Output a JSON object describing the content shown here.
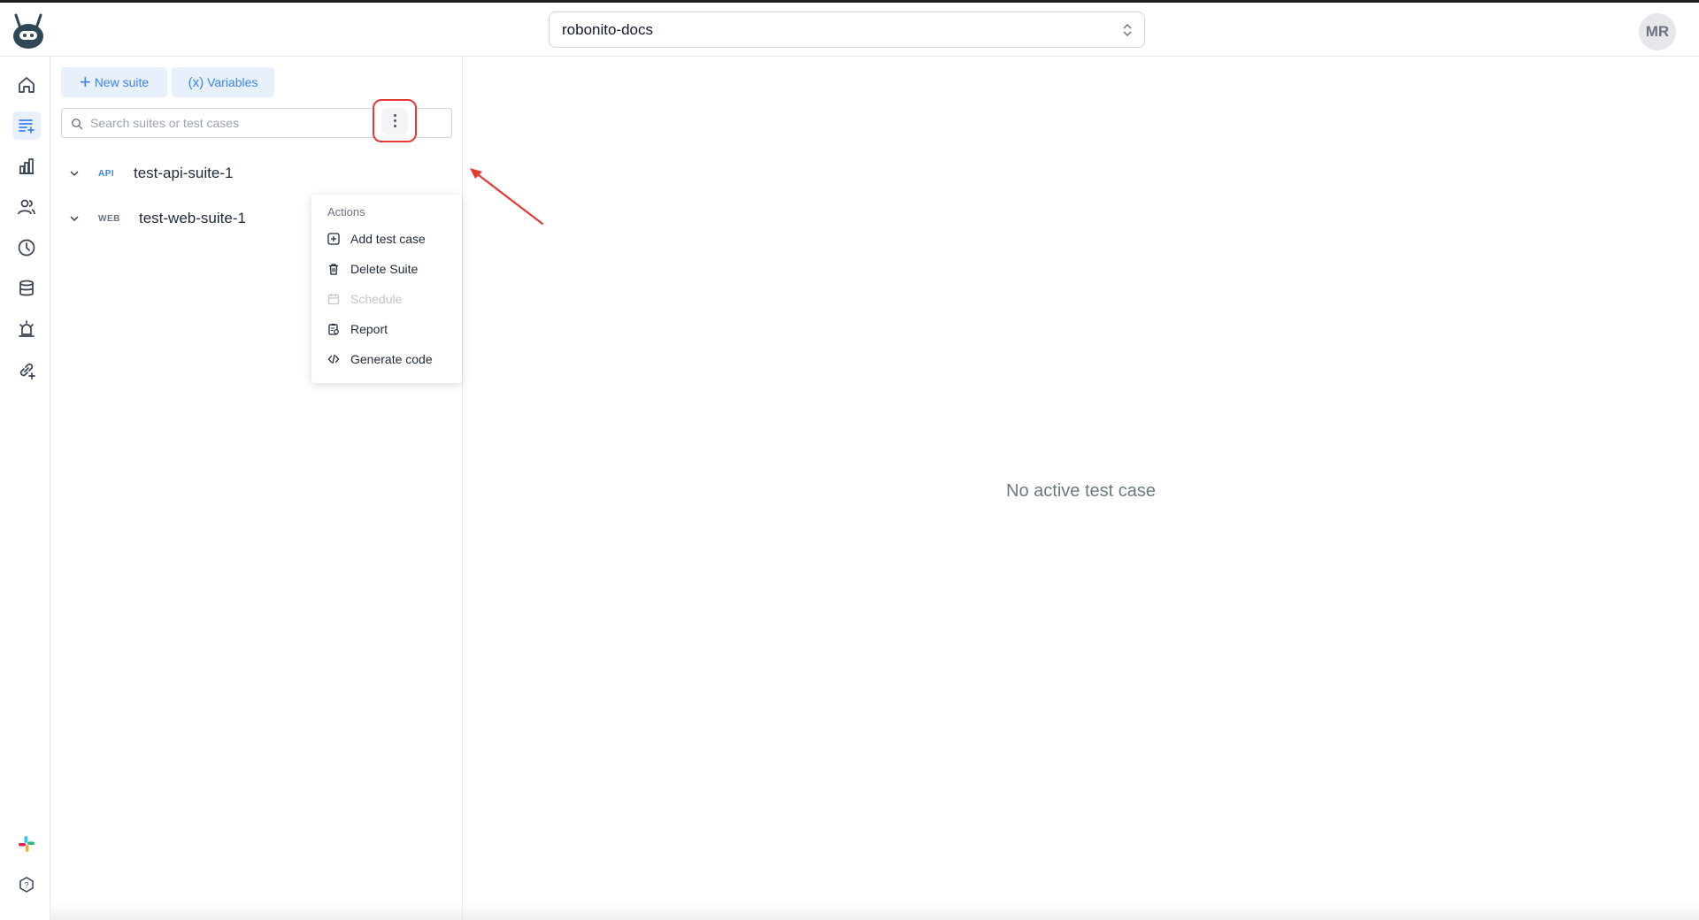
{
  "header": {
    "project_name": "robonito-docs",
    "avatar_initials": "MR"
  },
  "rail": {
    "items": [
      "home-icon",
      "test-suites-icon",
      "reports-icon",
      "team-icon",
      "history-icon",
      "database-icon",
      "alerts-icon",
      "integrations-icon"
    ],
    "bottom": [
      "slack-icon",
      "help-icon"
    ],
    "active": "test-suites-icon"
  },
  "panel": {
    "new_suite_label": "New suite",
    "variables_label": "Variables",
    "variables_icon_text": "(x)",
    "search_placeholder": "Search suites or test cases",
    "suites": [
      {
        "type": "API",
        "name": "test-api-suite-1"
      },
      {
        "type": "WEB",
        "name": "test-web-suite-1"
      }
    ]
  },
  "menu": {
    "title": "Actions",
    "items": [
      {
        "label": "Add test case",
        "icon": "add-square-icon",
        "disabled": false
      },
      {
        "label": "Delete Suite",
        "icon": "trash-icon",
        "disabled": false
      },
      {
        "label": "Schedule",
        "icon": "calendar-icon",
        "disabled": true
      },
      {
        "label": "Report",
        "icon": "report-icon",
        "disabled": false
      },
      {
        "label": "Generate code",
        "icon": "code-icon",
        "disabled": false
      }
    ]
  },
  "main": {
    "empty_text": "No active test case"
  },
  "colors": {
    "accent": "#3b82f6",
    "highlight": "#e53935",
    "active_bg": "#e8f1fb"
  }
}
